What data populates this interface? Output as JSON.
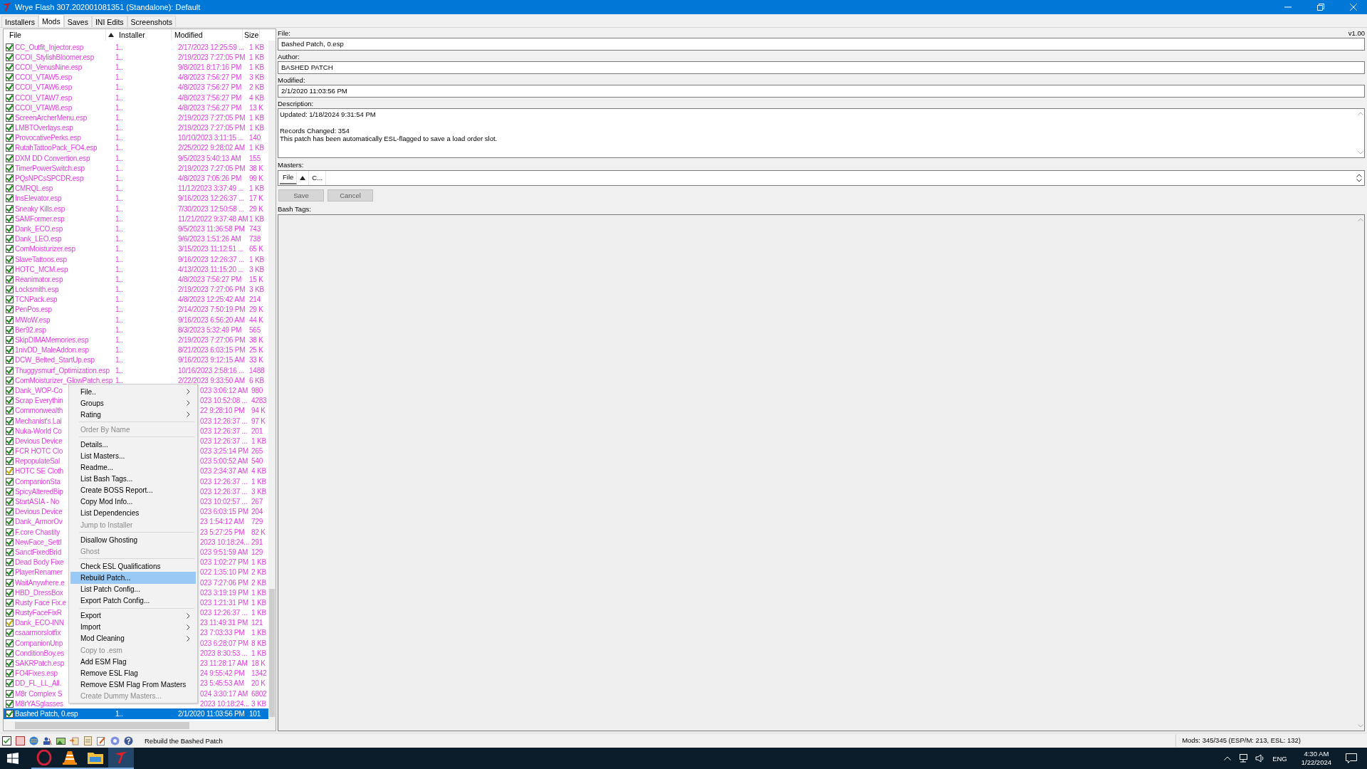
{
  "window": {
    "title": "Wrye Flash 307.202001081351 (Standalone): Default"
  },
  "tabs": [
    {
      "label": "Installers",
      "selected": false
    },
    {
      "label": "Mods",
      "selected": true
    },
    {
      "label": "Saves",
      "selected": false
    },
    {
      "label": "INI Edits",
      "selected": false
    },
    {
      "label": "Screenshots",
      "selected": false
    }
  ],
  "mods_table": {
    "columns": [
      "File",
      "Installer",
      "Modified",
      "Size"
    ],
    "rows": [
      {
        "kind": "full",
        "name": "CC_Outfit_Injector.esp",
        "installer": "1..",
        "modified": "2/17/2023 12:25:59 ...",
        "size": "1 KB",
        "color": "#1f9a1f",
        "selected": false
      },
      {
        "kind": "full",
        "name": "CCOI_StylishBloomer.esp",
        "installer": "1..",
        "modified": "2/19/2023 7:27:05 PM",
        "size": "1 KB",
        "color": "#1f9a1f",
        "selected": false
      },
      {
        "kind": "full",
        "name": "CCOI_VenusNine.esp",
        "installer": "1..",
        "modified": "9/8/2021 8:17:16 PM",
        "size": "1 KB",
        "color": "#1f9a1f",
        "selected": false
      },
      {
        "kind": "full",
        "name": "CCOI_VTAW5.esp",
        "installer": "1..",
        "modified": "4/8/2023 7:56:27 PM",
        "size": "3 KB",
        "color": "#1f9a1f",
        "selected": false
      },
      {
        "kind": "full",
        "name": "CCOI_VTAW6.esp",
        "installer": "1..",
        "modified": "4/8/2023 7:56:27 PM",
        "size": "2 KB",
        "color": "#1f9a1f",
        "selected": false
      },
      {
        "kind": "full",
        "name": "CCOI_VTAW7.esp",
        "installer": "1..",
        "modified": "4/8/2023 7:56:27 PM",
        "size": "4 KB",
        "color": "#1f9a1f",
        "selected": false
      },
      {
        "kind": "full",
        "name": "CCOI_VTAW8.esp",
        "installer": "1..",
        "modified": "4/8/2023 7:56:27 PM",
        "size": "13 K",
        "color": "#1f9a1f",
        "selected": false
      },
      {
        "kind": "full",
        "name": "ScreenArcherMenu.esp",
        "installer": "1..",
        "modified": "2/19/2023 7:27:05 PM",
        "size": "1 KB",
        "color": "#1f9a1f",
        "selected": false
      },
      {
        "kind": "full",
        "name": "LMBTOverlays.esp",
        "installer": "1..",
        "modified": "2/19/2023 7:27:05 PM",
        "size": "1 KB",
        "color": "#1f9a1f",
        "selected": false
      },
      {
        "kind": "full",
        "name": "ProvocativePerks.esp",
        "installer": "1..",
        "modified": "10/10/2023 3:11:15 ...",
        "size": "140",
        "color": "#1f9a1f",
        "selected": false
      },
      {
        "kind": "full",
        "name": "RutahTattooPack_FO4.esp",
        "installer": "1..",
        "modified": "2/25/2022 9:28:02 AM",
        "size": "1 KB",
        "color": "#1f9a1f",
        "selected": false
      },
      {
        "kind": "full",
        "name": "DXM DD Convertion.esp",
        "installer": "1..",
        "modified": "9/5/2023 5:40:13 AM",
        "size": "155",
        "color": "#1f9a1f",
        "selected": false
      },
      {
        "kind": "full",
        "name": "TimerPowerSwitch.esp",
        "installer": "1..",
        "modified": "2/19/2023 7:27:05 PM",
        "size": "38 K",
        "color": "#1f9a1f",
        "selected": false
      },
      {
        "kind": "full",
        "name": "PQsNPCsSPCDR.esp",
        "installer": "1..",
        "modified": "4/8/2023 7:05:26 PM",
        "size": "99 K",
        "color": "#1f9a1f",
        "selected": false
      },
      {
        "kind": "full",
        "name": "CMRQL.esp",
        "installer": "1..",
        "modified": "11/12/2023 3:37:49 ...",
        "size": "1 KB",
        "color": "#1f9a1f",
        "selected": false
      },
      {
        "kind": "full",
        "name": "InsElevator.esp",
        "installer": "1..",
        "modified": "9/16/2023 12:26:37 ...",
        "size": "17 K",
        "color": "#1f9a1f",
        "selected": false
      },
      {
        "kind": "full",
        "name": "Sneaky Kills.esp",
        "installer": "1..",
        "modified": "7/30/2023 12:50:58 ...",
        "size": "29 K",
        "color": "#1f9a1f",
        "selected": false
      },
      {
        "kind": "full",
        "name": "SAMFormer.esp",
        "installer": "1..",
        "modified": "11/21/2022 9:37:48 AM",
        "size": "1 KB",
        "color": "#1f9a1f",
        "selected": false
      },
      {
        "kind": "full",
        "name": "Dank_ECO.esp",
        "installer": "1..",
        "modified": "9/5/2023 11:36:58 PM",
        "size": "743",
        "color": "#1f9a1f",
        "selected": false
      },
      {
        "kind": "full",
        "name": "Dank_LEO.esp",
        "installer": "1..",
        "modified": "9/6/2023 1:51:26 AM",
        "size": "738",
        "color": "#1f9a1f",
        "selected": false
      },
      {
        "kind": "full",
        "name": "ComMoisturizer.esp",
        "installer": "1..",
        "modified": "3/15/2023 11:12:51 ...",
        "size": "65 K",
        "color": "#1f9a1f",
        "selected": false
      },
      {
        "kind": "full",
        "name": "SlaveTattoos.esp",
        "installer": "1..",
        "modified": "9/16/2023 12:26:37 ...",
        "size": "1 KB",
        "color": "#1f9a1f",
        "selected": false
      },
      {
        "kind": "full",
        "name": "HOTC_MCM.esp",
        "installer": "1..",
        "modified": "4/13/2023 11:15:20 ...",
        "size": "3 KB",
        "color": "#1f9a1f",
        "selected": false
      },
      {
        "kind": "full",
        "name": "Reanimator.esp",
        "installer": "1..",
        "modified": "4/8/2023 7:56:27 PM",
        "size": "15 K",
        "color": "#1f9a1f",
        "selected": false
      },
      {
        "kind": "full",
        "name": "Locksmith.esp",
        "installer": "1..",
        "modified": "2/19/2023 7:27:06 PM",
        "size": "3 KB",
        "color": "#1f9a1f",
        "selected": false
      },
      {
        "kind": "full",
        "name": "TCNPack.esp",
        "installer": "1..",
        "modified": "4/8/2023 12:25:42 AM",
        "size": "214",
        "color": "#1f9a1f",
        "selected": false
      },
      {
        "kind": "full",
        "name": "PenPos.esp",
        "installer": "1..",
        "modified": "2/14/2023 7:50:19 PM",
        "size": "29 K",
        "color": "#1f9a1f",
        "selected": false
      },
      {
        "kind": "full",
        "name": "MWoW.esp",
        "installer": "1..",
        "modified": "9/16/2023 6:56:20 AM",
        "size": "44 K",
        "color": "#1f9a1f",
        "selected": false
      },
      {
        "kind": "full",
        "name": "Ber92.esp",
        "installer": "1..",
        "modified": "8/3/2023 5:32:49 PM",
        "size": "565",
        "color": "#1f9a1f",
        "selected": false
      },
      {
        "kind": "full",
        "name": "SkipDIMAMemories.esp",
        "installer": "1..",
        "modified": "2/19/2023 7:27:06 PM",
        "size": "38 K",
        "color": "#1f9a1f",
        "selected": false
      },
      {
        "kind": "full",
        "name": "1nivDD_MaleAddon.esp",
        "installer": "1..",
        "modified": "8/21/2023 6:03:15 PM",
        "size": "25 K",
        "color": "#1f9a1f",
        "selected": false
      },
      {
        "kind": "full",
        "name": "DCW_Belted_StartUp.esp",
        "installer": "1..",
        "modified": "9/16/2023 9:12:15 AM",
        "size": "33 K",
        "color": "#1f9a1f",
        "selected": false
      },
      {
        "kind": "full",
        "name": "Thuggysmurf_Optimization.esp",
        "installer": "1..",
        "modified": "10/16/2023 2:58:16 ...",
        "size": "1488",
        "color": "#1f9a1f",
        "selected": false
      },
      {
        "kind": "full",
        "name": "ComMoisturizer_GlowPatch.esp",
        "installer": "1..",
        "modified": "2/22/2023 9:33:50 AM",
        "size": "6 KB",
        "color": "#1f9a1f",
        "selected": false
      },
      {
        "kind": "covered",
        "name": "Dank_WOP-Co",
        "modified": "023 3:06:12 AM",
        "size": "980",
        "color": "#1f9a1f",
        "selected": false
      },
      {
        "kind": "covered",
        "name": "Scrap Everythin",
        "modified": "023 10:52:08 ...",
        "size": "4283",
        "color": "#1f9a1f",
        "selected": false
      },
      {
        "kind": "covered",
        "name": "Commonwealth",
        "modified": "22 9:28:10 PM",
        "size": "94 K",
        "color": "#1f9a1f",
        "selected": false
      },
      {
        "kind": "covered",
        "name": "Mechanist's Lai",
        "modified": "023 12:26:37 ...",
        "size": "97 K",
        "color": "#1f9a1f",
        "selected": false
      },
      {
        "kind": "covered",
        "name": "Nuka-World Co",
        "modified": "023 12:26:37 ...",
        "size": "201",
        "color": "#1f9a1f",
        "selected": false
      },
      {
        "kind": "covered",
        "name": "Devious Device",
        "modified": "023 12:26:37 ...",
        "size": "1 KB",
        "color": "#1f9a1f",
        "selected": false
      },
      {
        "kind": "covered",
        "name": "FCR HOTC Clo",
        "modified": "023 3:25:14 PM",
        "size": "265",
        "color": "#1f9a1f",
        "selected": false
      },
      {
        "kind": "covered",
        "name": "RepopulateSal",
        "modified": "023 5:00:52 AM",
        "size": "540",
        "color": "#1f9a1f",
        "selected": false
      },
      {
        "kind": "covered",
        "name": "HOTC SE Cloth",
        "modified": "023 2:34:37 AM",
        "size": "4 KB",
        "color": "#c8b400",
        "selected": false
      },
      {
        "kind": "covered",
        "name": "CompanionSta",
        "modified": "023 12:26:37 ...",
        "size": "1 KB",
        "color": "#1f9a1f",
        "selected": false
      },
      {
        "kind": "covered",
        "name": "SpicyAlteredBip",
        "modified": "023 12:26:37 ...",
        "size": "3 KB",
        "color": "#1f9a1f",
        "selected": false
      },
      {
        "kind": "covered",
        "name": "StartASIA - No",
        "modified": "023 10:02:57 ...",
        "size": "267",
        "color": "#1f9a1f",
        "selected": false
      },
      {
        "kind": "covered",
        "name": "Devious Device",
        "modified": "023 6:03:15 PM",
        "size": "204",
        "color": "#1f9a1f",
        "selected": false
      },
      {
        "kind": "covered",
        "name": "Dank_ArmorOv",
        "modified": "23 1:54:12 AM",
        "size": "729",
        "color": "#1f9a1f",
        "selected": false
      },
      {
        "kind": "covered",
        "name": "F.core Chastity",
        "modified": "23 5:27:25 PM",
        "size": "82 K",
        "color": "#1f9a1f",
        "selected": false
      },
      {
        "kind": "covered",
        "name": "NewFace_Settl",
        "modified": "2023 10:18:24...",
        "size": "291",
        "color": "#1f9a1f",
        "selected": false
      },
      {
        "kind": "covered",
        "name": "SanctFixedBrid",
        "modified": "023 9:51:59 AM",
        "size": "129",
        "color": "#1f9a1f",
        "selected": false
      },
      {
        "kind": "covered",
        "name": "Dead Body Fixe",
        "modified": "023 1:02:27 PM",
        "size": "1 KB",
        "color": "#1f9a1f",
        "selected": false
      },
      {
        "kind": "covered",
        "name": "PlayerRenamer",
        "modified": "022 1:35:10 PM",
        "size": "2 KB",
        "color": "#1f9a1f",
        "selected": false
      },
      {
        "kind": "covered",
        "name": "WaitAnywhere.e",
        "modified": "023 7:27:06 PM",
        "size": "2 KB",
        "color": "#1f9a1f",
        "selected": false
      },
      {
        "kind": "covered",
        "name": "HBD_DressBox",
        "modified": "023 3:19:19 PM",
        "size": "1 KB",
        "color": "#1f9a1f",
        "selected": false
      },
      {
        "kind": "covered",
        "name": "Rusty Face Fix.e",
        "modified": "023 1:21:31 PM",
        "size": "1 KB",
        "color": "#1f9a1f",
        "selected": false
      },
      {
        "kind": "covered",
        "name": "RustyFaceFixR",
        "modified": "023 12:26:37 ...",
        "size": "1 KB",
        "color": "#1f9a1f",
        "selected": false
      },
      {
        "kind": "covered",
        "name": "Dank_ECO-INN",
        "modified": "23 11:49:31 PM",
        "size": "121",
        "color": "#c8b400",
        "selected": false
      },
      {
        "kind": "covered",
        "name": "csaarmorslotfix",
        "modified": "23 7:03:33 PM",
        "size": "1 KB",
        "color": "#1f9a1f",
        "selected": false
      },
      {
        "kind": "covered",
        "name": "CompanionUnp",
        "modified": "023 6:28:07 PM",
        "size": "8 KB",
        "color": "#1f9a1f",
        "selected": false
      },
      {
        "kind": "covered",
        "name": "ConditionBoy.es",
        "modified": "2023 8:30:53 ...",
        "size": "1 KB",
        "color": "#1f9a1f",
        "selected": false
      },
      {
        "kind": "covered",
        "name": "SAKRPatch.esp",
        "modified": "23 11:28:17 AM",
        "size": "18 K",
        "color": "#1f9a1f",
        "selected": false
      },
      {
        "kind": "covered",
        "name": "FO4Fixes.esp",
        "modified": "24 9:55:42 PM",
        "size": "1342",
        "color": "#1f9a1f",
        "selected": false
      },
      {
        "kind": "covered",
        "name": "DD_FL_LL_All.",
        "modified": "23 5:45:53 AM",
        "size": "20 K",
        "color": "#1f9a1f",
        "selected": false
      },
      {
        "kind": "covered",
        "name": "M8r Complex S",
        "modified": "024 3:30:17 AM",
        "size": "6802",
        "color": "#1f9a1f",
        "selected": false
      },
      {
        "kind": "covered",
        "name": "M8rYASglasses",
        "modified": "2023 10:18:24...",
        "size": "3 KB",
        "color": "#1f9a1f",
        "selected": false
      },
      {
        "kind": "full",
        "name": "Bashed Patch, 0.esp",
        "installer": "1..",
        "modified": "2/1/2020 11:03:56 PM",
        "size": "101",
        "color": "#1f9a1f",
        "selected": true
      }
    ]
  },
  "context_menu": [
    {
      "kind": "item",
      "label": "File..",
      "submenu": true,
      "disabled": false,
      "selected": false
    },
    {
      "kind": "item",
      "label": "Groups",
      "submenu": true,
      "disabled": false,
      "selected": false
    },
    {
      "kind": "item",
      "label": "Rating",
      "submenu": true,
      "disabled": false,
      "selected": false
    },
    {
      "kind": "separator"
    },
    {
      "kind": "item",
      "label": "Order By Name",
      "submenu": false,
      "disabled": true,
      "selected": false
    },
    {
      "kind": "separator"
    },
    {
      "kind": "item",
      "label": "Details...",
      "submenu": false,
      "disabled": false,
      "selected": false
    },
    {
      "kind": "item",
      "label": "List Masters...",
      "submenu": false,
      "disabled": false,
      "selected": false
    },
    {
      "kind": "item",
      "label": "Readme...",
      "submenu": false,
      "disabled": false,
      "selected": false
    },
    {
      "kind": "item",
      "label": "List Bash Tags...",
      "submenu": false,
      "disabled": false,
      "selected": false
    },
    {
      "kind": "item",
      "label": "Create BOSS Report...",
      "submenu": false,
      "disabled": false,
      "selected": false
    },
    {
      "kind": "item",
      "label": "Copy Mod Info...",
      "submenu": false,
      "disabled": false,
      "selected": false
    },
    {
      "kind": "item",
      "label": "List Dependencies",
      "submenu": false,
      "disabled": false,
      "selected": false
    },
    {
      "kind": "item",
      "label": "Jump to Installer",
      "submenu": false,
      "disabled": true,
      "selected": false
    },
    {
      "kind": "separator"
    },
    {
      "kind": "item",
      "label": "Disallow Ghosting",
      "submenu": false,
      "disabled": false,
      "selected": false
    },
    {
      "kind": "item",
      "label": "Ghost",
      "submenu": false,
      "disabled": true,
      "selected": false
    },
    {
      "kind": "separator"
    },
    {
      "kind": "item",
      "label": "Check ESL Qualifications",
      "submenu": false,
      "disabled": false,
      "selected": false
    },
    {
      "kind": "item",
      "label": "Rebuild Patch...",
      "submenu": false,
      "disabled": false,
      "selected": true
    },
    {
      "kind": "item",
      "label": "List Patch Config...",
      "submenu": false,
      "disabled": false,
      "selected": false
    },
    {
      "kind": "item",
      "label": "Export Patch Config...",
      "submenu": false,
      "disabled": false,
      "selected": false
    },
    {
      "kind": "separator"
    },
    {
      "kind": "item",
      "label": "Export",
      "submenu": true,
      "disabled": false,
      "selected": false
    },
    {
      "kind": "item",
      "label": "Import",
      "submenu": true,
      "disabled": false,
      "selected": false
    },
    {
      "kind": "item",
      "label": "Mod Cleaning",
      "submenu": true,
      "disabled": false,
      "selected": false
    },
    {
      "kind": "item",
      "label": "Copy to .esm",
      "submenu": false,
      "disabled": true,
      "selected": false
    },
    {
      "kind": "item",
      "label": "Add ESM Flag",
      "submenu": false,
      "disabled": false,
      "selected": false
    },
    {
      "kind": "item",
      "label": "Remove ESL Flag",
      "submenu": false,
      "disabled": false,
      "selected": false
    },
    {
      "kind": "item",
      "label": "Remove ESM Flag From Masters",
      "submenu": false,
      "disabled": false,
      "selected": false
    },
    {
      "kind": "item",
      "label": "Create Dummy Masters...",
      "submenu": false,
      "disabled": true,
      "selected": false
    }
  ],
  "details": {
    "file_label": "File:",
    "version": "v1.00",
    "file": "Bashed Patch, 0.esp",
    "author_label": "Author:",
    "author": "BASHED PATCH",
    "modified_label": "Modified:",
    "modified": "2/1/2020 11:03:56 PM",
    "description_label": "Description:",
    "description": [
      [
        "Updated: 1/18/2024 9:31:54 PM"
      ],
      [
        "Records Changed: 354",
        "This patch has been automatically ESL-flagged to save a load order slot."
      ]
    ],
    "masters_label": "Masters:",
    "masters_columns": [
      "File",
      "C..."
    ],
    "buttons": [
      {
        "label": "Save",
        "disabled": true
      },
      {
        "label": "Cancel",
        "disabled": true
      }
    ],
    "bash_tags_label": "Bash Tags:"
  },
  "status_bar": {
    "message": "Rebuild the Bashed Patch",
    "counts": "Mods: 345/345 (ESP/M: 213, ESL: 132)"
  },
  "taskbar": {
    "language": "ENG",
    "time": "4:30 AM",
    "date": "1/22/2024"
  }
}
